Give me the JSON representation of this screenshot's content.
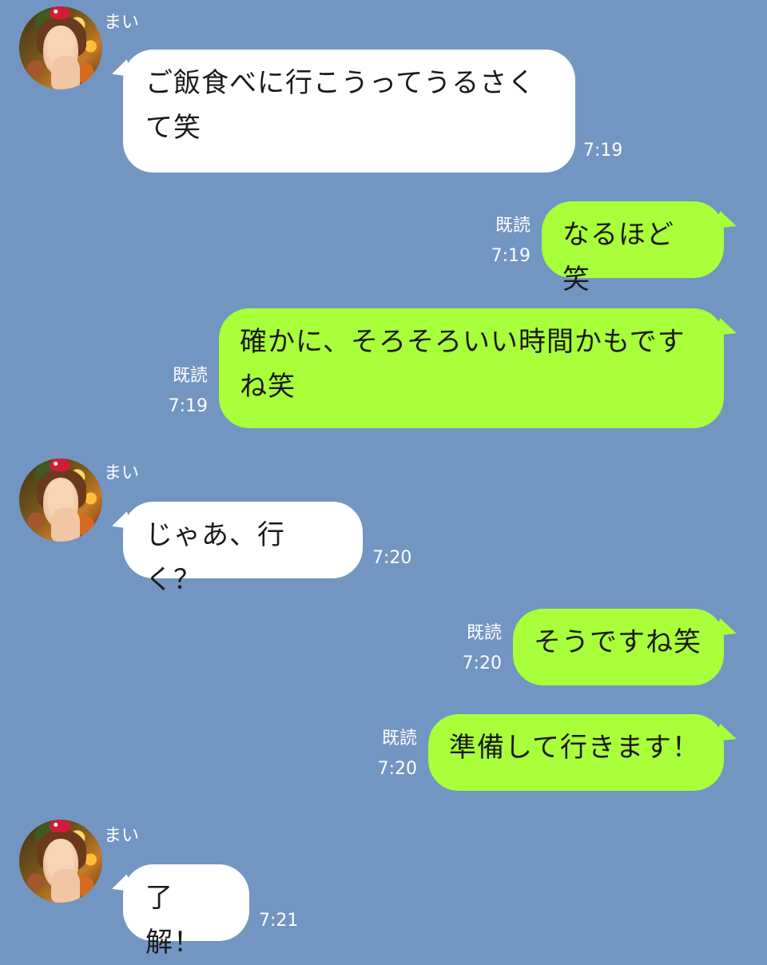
{
  "theme": {
    "background": "#7395c2",
    "incoming_bubble": "#ffffff",
    "outgoing_bubble": "#a8ff3a",
    "meta_text": "#ffffff"
  },
  "contact": {
    "name": "まい",
    "avatar_icon": "contact-avatar"
  },
  "messages": [
    {
      "direction": "in",
      "text": "ご飯食べに行こうってうるさくて笑",
      "time": "7:19"
    },
    {
      "direction": "out",
      "text": "なるほど笑",
      "read": "既読",
      "time": "7:19"
    },
    {
      "direction": "out",
      "text": "確かに、そろそろいい時間かもですね笑",
      "read": "既読",
      "time": "7:19"
    },
    {
      "direction": "in",
      "text": "じゃあ、行く？",
      "time": "7:20"
    },
    {
      "direction": "out",
      "text": "そうですね笑",
      "read": "既読",
      "time": "7:20"
    },
    {
      "direction": "out",
      "text": "準備して行きます！",
      "read": "既読",
      "time": "7:20"
    },
    {
      "direction": "in",
      "text": "了解！",
      "time": "7:21"
    }
  ]
}
